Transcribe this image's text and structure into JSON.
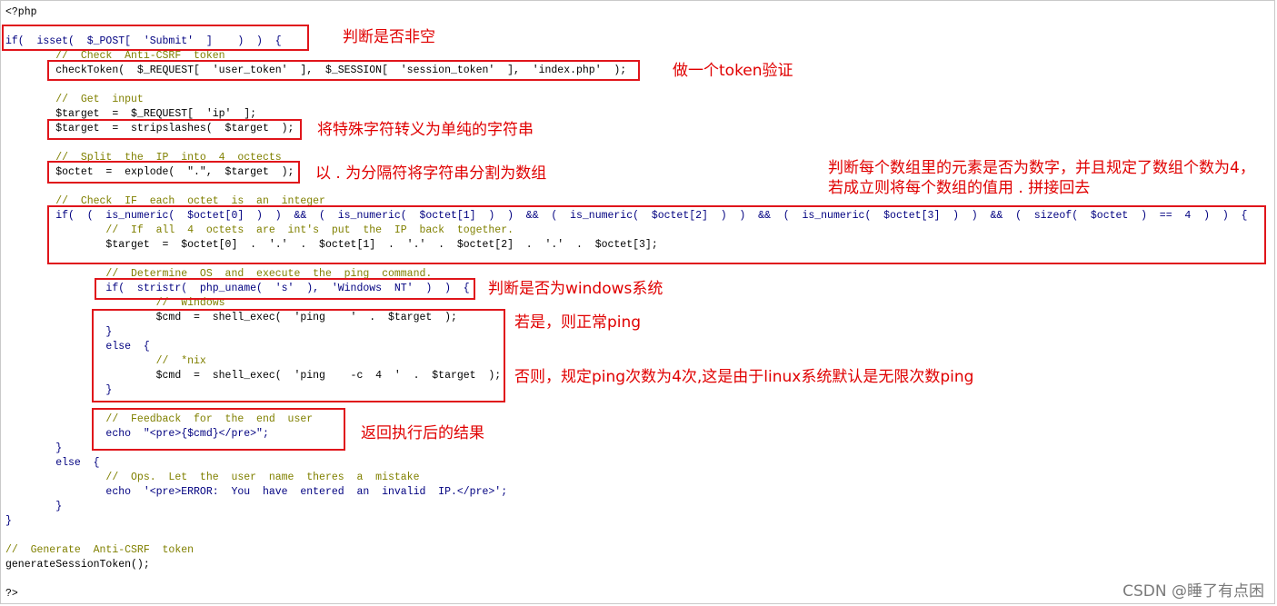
{
  "code_lines": [
    "<?php",
    "",
    "if(  isset(  $_POST[  'Submit'  ]    )  )  {",
    "        //  Check  Anti-CSRF  token",
    "        checkToken(  $_REQUEST[  'user_token'  ],  $_SESSION[  'session_token'  ],  'index.php'  );",
    "",
    "        //  Get  input",
    "        $target  =  $_REQUEST[  'ip'  ];",
    "        $target  =  stripslashes(  $target  );",
    "",
    "        //  Split  the  IP  into  4  octects",
    "        $octet  =  explode(  \".\",  $target  );",
    "",
    "        //  Check  IF  each  octet  is  an  integer",
    "        if(  (  is_numeric(  $octet[0]  )  )  &&  (  is_numeric(  $octet[1]  )  )  &&  (  is_numeric(  $octet[2]  )  )  &&  (  is_numeric(  $octet[3]  )  )  &&  (  sizeof(  $octet  )  ==  4  )  )  {",
    "                //  If  all  4  octets  are  int's  put  the  IP  back  together.",
    "                $target  =  $octet[0]  .  '.'  .  $octet[1]  .  '.'  .  $octet[2]  .  '.'  .  $octet[3];",
    "",
    "                //  Determine  OS  and  execute  the  ping  command.",
    "                if(  stristr(  php_uname(  's'  ),  'Windows  NT'  )  )  {",
    "                        //  Windows",
    "                        $cmd  =  shell_exec(  'ping    '  .  $target  );",
    "                }",
    "                else  {",
    "                        //  *nix",
    "                        $cmd  =  shell_exec(  'ping    -c  4  '  .  $target  );",
    "                }",
    "",
    "                //  Feedback  for  the  end  user",
    "                echo  \"<pre>{$cmd}</pre>\";",
    "        }",
    "        else  {",
    "                //  Ops.  Let  the  user  name  theres  a  mistake",
    "                echo  '<pre>ERROR:  You  have  entered  an  invalid  IP.</pre>';",
    "        }",
    "}",
    "",
    "//  Generate  Anti-CSRF  token",
    "generateSessionToken();",
    "",
    "?>"
  ],
  "annotations": {
    "not_empty": "判断是否非空",
    "token_check": "做一个token验证",
    "escape": "将特殊字符转义为单纯的字符串",
    "split": "以 . 为分隔符将字符串分割为数组",
    "numeric_line1": "判断每个数组里的元素是否为数字，并且规定了数组个数为4，",
    "numeric_line2": "若成立则将每个数组的值用 . 拼接回去",
    "windows": "判断是否为windows系统",
    "if_windows": "若是，则正常ping",
    "else_linux": "否则，规定ping次数为4次,这是由于linux系统默认是无限次数ping",
    "feedback": "返回执行后的结果"
  },
  "watermark": "CSDN @睡了有点困",
  "colors": {
    "keyword": "#000080",
    "comment": "#808000",
    "annotation": "#e00000",
    "box": "#e0151b"
  }
}
